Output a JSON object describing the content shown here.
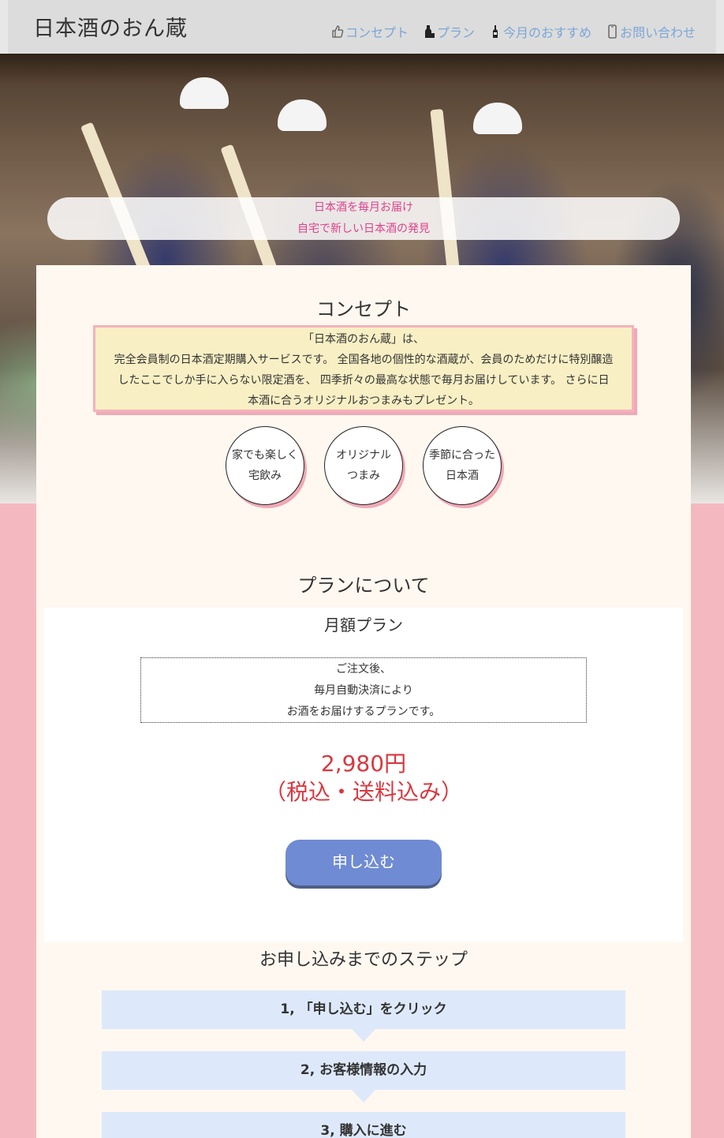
{
  "header": {
    "logo": "日本酒のおん蔵",
    "nav": [
      {
        "label": "コンセプト",
        "icon": "thumbs-up-icon"
      },
      {
        "label": "プラン",
        "icon": "sake-bottle-icon"
      },
      {
        "label": "今月のおすすめ",
        "icon": "bottle-icon"
      },
      {
        "label": "お問い合わせ",
        "icon": "mobile-phone-icon"
      }
    ]
  },
  "hero": {
    "tagline_1": "日本酒を毎月お届け",
    "tagline_2": "自宅で新しい日本酒の発見"
  },
  "concept": {
    "title": "コンセプト",
    "lines": [
      "「日本酒のおん蔵」は、",
      "完全会員制の日本酒定期購入サービスです。 全国各地の個性的な酒蔵が、会員のためだけに特別醸造",
      "したここでしか手に入らない限定酒を、 四季折々の最高な状態で毎月お届けしています。 さらに日",
      "本酒に合うオリジナルおつまみもプレゼント。"
    ],
    "features": [
      {
        "line1": "家でも楽しく",
        "line2": "宅飲み"
      },
      {
        "line1": "オリジナル",
        "line2": "つまみ"
      },
      {
        "line1": "季節に合った",
        "line2": "日本酒"
      }
    ]
  },
  "plan": {
    "title": "プランについて",
    "name": "月額プラン",
    "desc": [
      "ご注文後、",
      "毎月自動決済により",
      "お酒をお届けするプランです。"
    ],
    "price": "2,980円",
    "price_note": "（税込・送料込み）",
    "apply_label": "申し込む"
  },
  "steps": {
    "title": "お申し込みまでのステップ",
    "items": [
      "1, 「申し込む」をクリック",
      "2, お客様情報の入力",
      "3, 購入に進む"
    ]
  },
  "colors": {
    "accent_pink": "#f4b9c0",
    "nav_link": "#7aa6d6",
    "price_red": "#d9383f",
    "button_blue": "#6f8bd3",
    "step_bg": "#dde9fb"
  }
}
